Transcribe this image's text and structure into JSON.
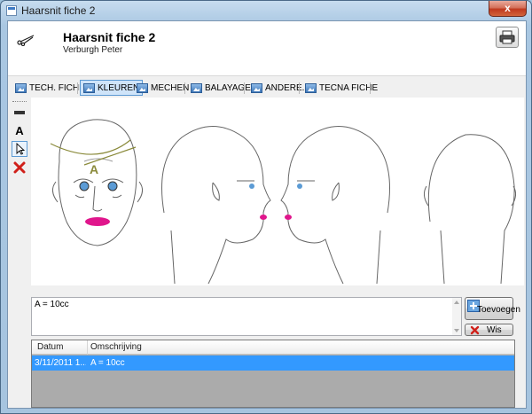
{
  "window": {
    "title": "Haarsnit fiche 2",
    "close_glyph": "x"
  },
  "header": {
    "title": "Haarsnit fiche 2",
    "subtitle": "Verburgh Peter"
  },
  "tabs": [
    {
      "label": "TECH. FICHE",
      "active": false
    },
    {
      "label": "KLEUREN",
      "active": true
    },
    {
      "label": "MECHEN",
      "active": false
    },
    {
      "label": "BALAYAGE",
      "active": false
    },
    {
      "label": "ANDERE.",
      "active": false
    },
    {
      "label": "TECNA FICHE",
      "active": false
    }
  ],
  "tools": {
    "text_tool_label": "A"
  },
  "canvas": {
    "annotation_label": "A",
    "annotation_color": "#8a8a3a",
    "lip_color": "#e0168c"
  },
  "note": {
    "value": "A = 10cc"
  },
  "buttons": {
    "add_label": "Toevoegen",
    "clear_label": "Wis"
  },
  "grid": {
    "columns": [
      "Datum",
      "Omschrijving"
    ],
    "rows": [
      {
        "date": "3/11/2011 1...",
        "description": "A = 10cc"
      }
    ],
    "selected_color": "#3399ff"
  }
}
